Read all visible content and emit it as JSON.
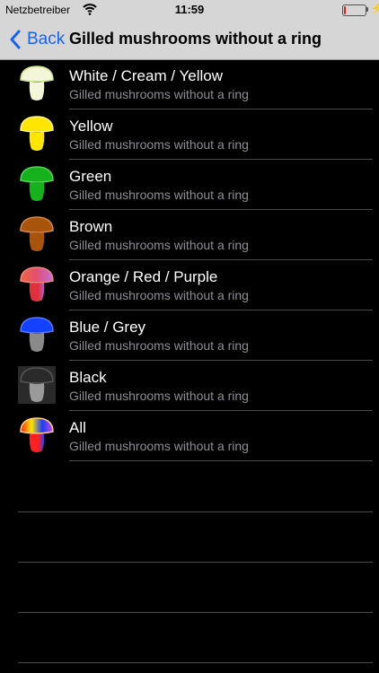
{
  "status_bar": {
    "carrier": "Netzbetreiber",
    "time": "11:59",
    "battery_level": 0.1
  },
  "nav": {
    "back_label": "Back",
    "title": "Gilled mushrooms without a ring"
  },
  "colors": {
    "accent": "#1464f0",
    "subtitle": "#8e8e93",
    "separator": "#4a4a4a",
    "background": "#000000"
  },
  "items": [
    {
      "label": "White / Cream / Yellow",
      "subtitle": "Gilled mushrooms without a ring",
      "icon": "mushroom-white-icon"
    },
    {
      "label": "Yellow",
      "subtitle": "Gilled mushrooms without a ring",
      "icon": "mushroom-yellow-icon"
    },
    {
      "label": "Green",
      "subtitle": "Gilled mushrooms without a ring",
      "icon": "mushroom-green-icon"
    },
    {
      "label": "Brown",
      "subtitle": "Gilled mushrooms without a ring",
      "icon": "mushroom-brown-icon"
    },
    {
      "label": "Orange / Red / Purple",
      "subtitle": "Gilled mushrooms without a ring",
      "icon": "mushroom-orange-icon"
    },
    {
      "label": "Blue / Grey",
      "subtitle": "Gilled mushrooms without a ring",
      "icon": "mushroom-blue-icon"
    },
    {
      "label": "Black",
      "subtitle": "Gilled mushrooms without a ring",
      "icon": "mushroom-black-icon"
    },
    {
      "label": "All",
      "subtitle": "Gilled mushrooms without a ring",
      "icon": "mushroom-all-icon"
    }
  ]
}
